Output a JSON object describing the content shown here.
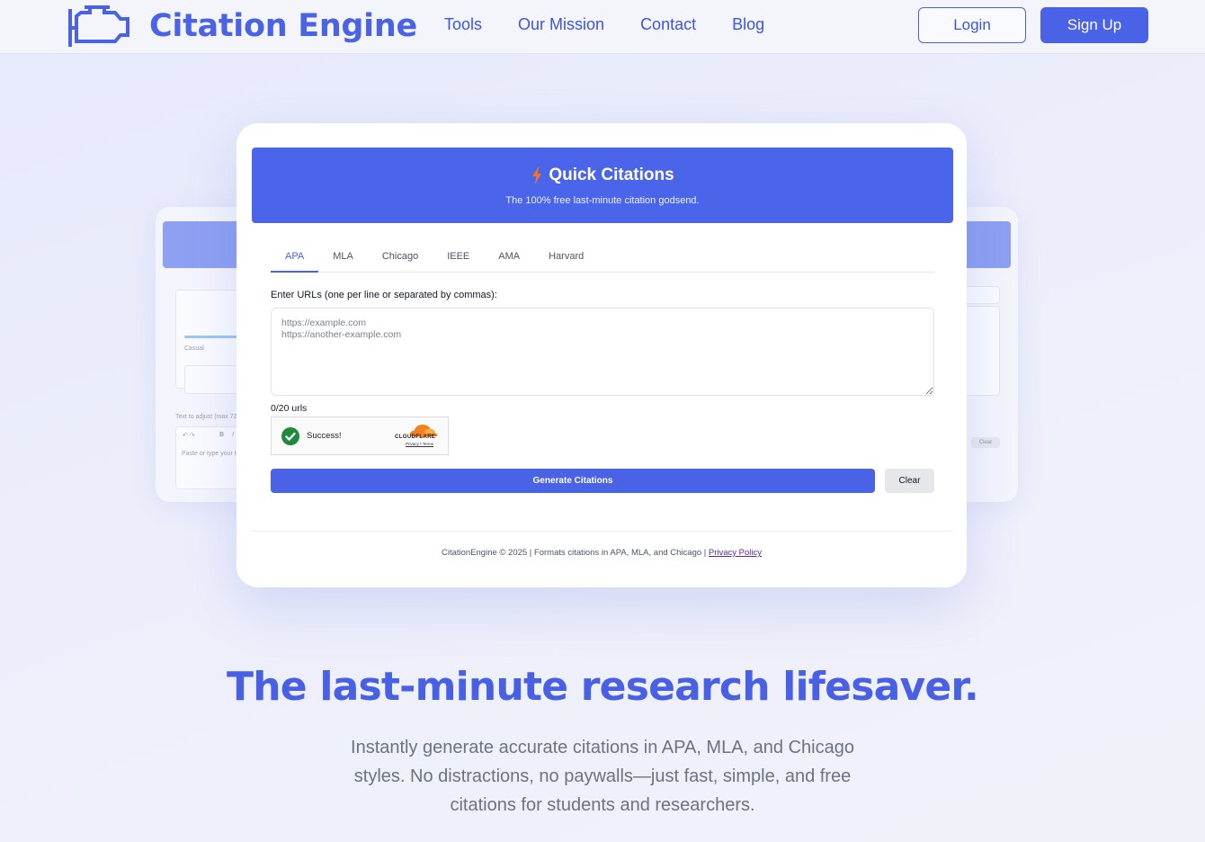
{
  "brand": {
    "name": "Citation Engine"
  },
  "nav": {
    "links": [
      "Tools",
      "Our Mission",
      "Contact",
      "Blog"
    ],
    "login_label": "Login",
    "signup_label": "Sign Up"
  },
  "tool": {
    "title": "Quick Citations",
    "subtitle": "The 100% free last-minute citation godsend.",
    "tabs": [
      "APA",
      "MLA",
      "Chicago",
      "IEEE",
      "AMA",
      "Harvard"
    ],
    "active_tab": "APA",
    "url_label": "Enter URLs (one per line or separated by commas):",
    "url_placeholder": "https://example.com\nhttps://another-example.com",
    "url_count": "0/20 urls",
    "captcha": {
      "status": "Success!",
      "provider": "CLOUDFLARE",
      "links": "Privacy • Terms"
    },
    "generate_label": "Generate Citations",
    "clear_label": "Clear",
    "footer_text": "CitationEngine © 2025 | Formats citations in APA, MLA, and Chicago | ",
    "privacy_label": "Privacy Policy"
  },
  "ghost": {
    "left_label_1": "Casual",
    "left_label_2": "Text to adjust (max 72",
    "left_placeholder": "Paste or type your te",
    "toolbar_b": "B",
    "toolbar_i": "I",
    "right_clear": "Clear"
  },
  "hero": {
    "title": "The last-minute research lifesaver.",
    "subtitle": "Instantly generate accurate citations in APA, MLA, and Chicago styles. No distractions, no paywalls—just fast, simple, and free citations for students and researchers."
  },
  "colors": {
    "accent": "#4a62e6",
    "bolt": "#f97316",
    "success": "#1e8a3a",
    "cloudflare": "#f48120"
  },
  "icons": {
    "brand": "engine-icon",
    "bolt": "bolt-icon",
    "check": "check-icon",
    "cloudflare": "cloudflare-logo"
  }
}
